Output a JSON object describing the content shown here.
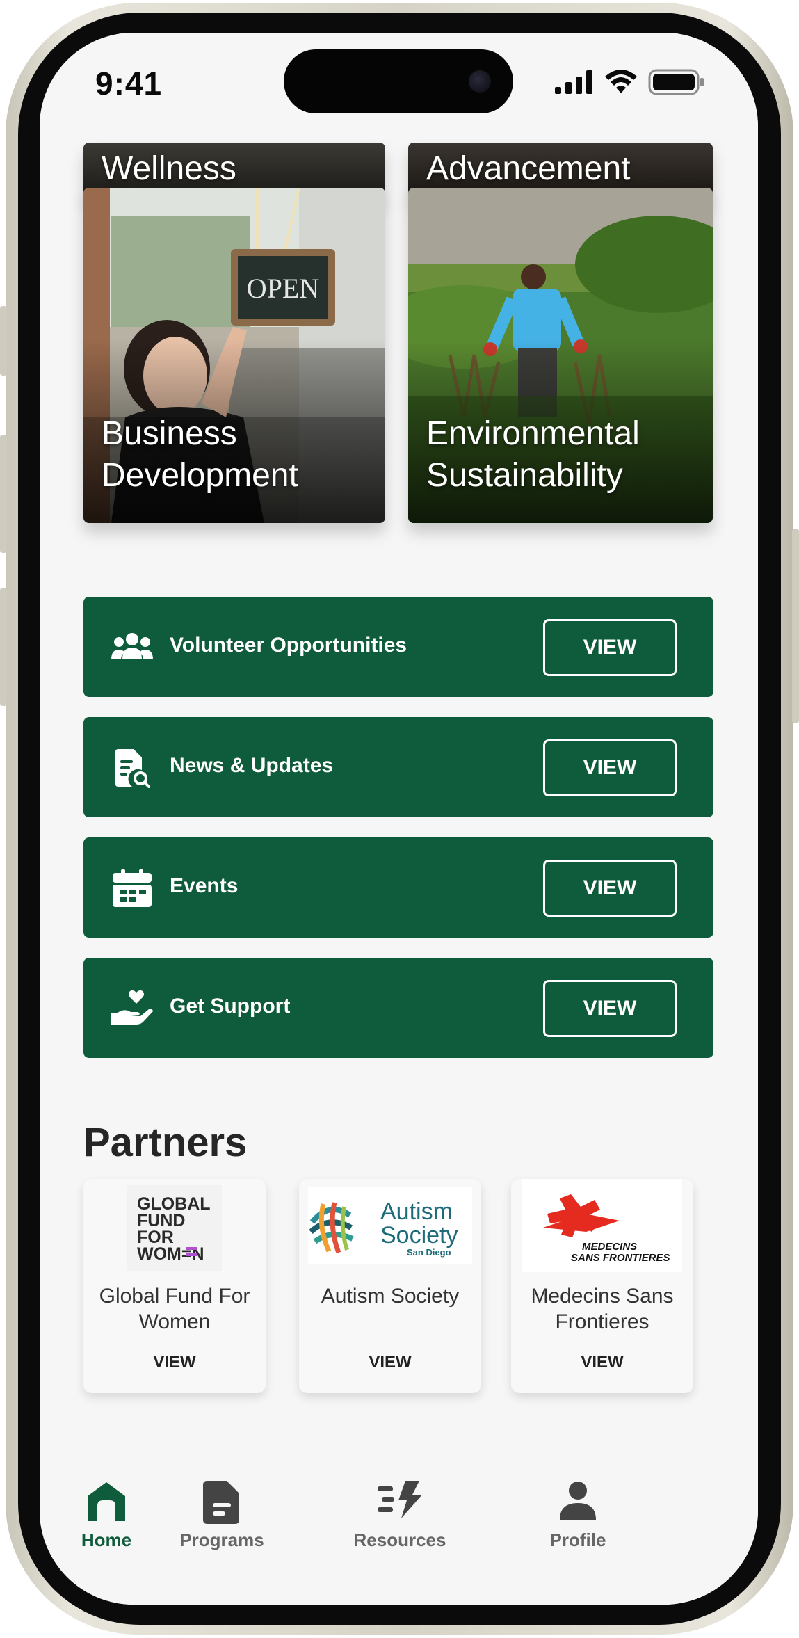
{
  "status_bar": {
    "time": "9:41"
  },
  "categories": [
    {
      "title": "Wellness",
      "partial": true
    },
    {
      "title": "Advancement",
      "partial": true
    },
    {
      "title": "Business Development",
      "image": "shop owner hanging open sign"
    },
    {
      "title": "Environmental Sustainability",
      "image": "person gardening in green field"
    }
  ],
  "actions": [
    {
      "label": "Volunteer Opportunities",
      "icon": "users-group-icon",
      "button": "VIEW"
    },
    {
      "label": "News & Updates",
      "icon": "document-search-icon",
      "button": "VIEW"
    },
    {
      "label": "Events",
      "icon": "calendar-icon",
      "button": "VIEW"
    },
    {
      "label": "Get Support",
      "icon": "hand-heart-icon",
      "button": "VIEW"
    }
  ],
  "partners": {
    "heading": "Partners",
    "items": [
      {
        "name": "Global Fund For Women",
        "view": "VIEW",
        "logo_lines": [
          "GLOBAL",
          "FUND",
          "FOR",
          "WOM=N"
        ]
      },
      {
        "name": "Autism Society",
        "view": "VIEW",
        "logo_lines": [
          "Autism",
          "Society",
          "San Diego"
        ]
      },
      {
        "name": "Medecins Sans Frontieres",
        "view": "VIEW",
        "logo_lines": [
          "MEDECINS",
          "SANS FRONTIERES"
        ]
      }
    ]
  },
  "tabs": [
    {
      "label": "Home",
      "icon": "home-icon",
      "active": true
    },
    {
      "label": "Programs",
      "icon": "document-icon",
      "active": false
    },
    {
      "label": "Resources",
      "icon": "resources-lightning-icon",
      "active": false
    },
    {
      "label": "Profile",
      "icon": "person-icon",
      "active": false
    }
  ],
  "colors": {
    "brand_green": "#0f5c3c",
    "background": "#f6f6f6",
    "text_dark": "#262626",
    "inactive_tab": "#666666"
  }
}
